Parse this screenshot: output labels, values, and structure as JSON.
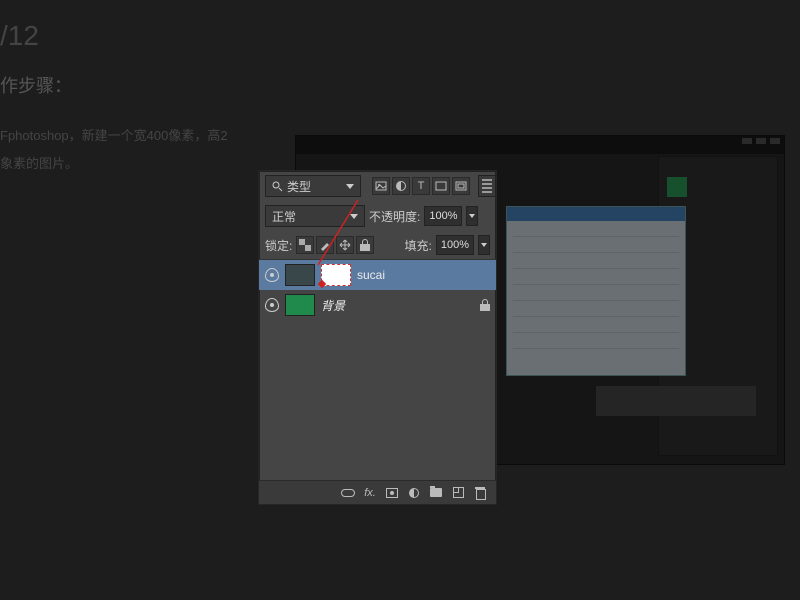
{
  "document": {
    "step_number": "/12",
    "step_title": "作步骤：",
    "body_line1": "Fphotoshop，新建一个宽400像素，高2",
    "body_line2": "象素的图片。"
  },
  "layers_panel": {
    "filter_type": "类型",
    "blend_mode": "正常",
    "opacity_label": "不透明度:",
    "opacity_value": "100%",
    "lock_label": "锁定:",
    "fill_label": "填充:",
    "fill_value": "100%",
    "layers": [
      {
        "name": "sucai",
        "selected": true
      },
      {
        "name": "背景",
        "selected": false,
        "locked": true
      }
    ],
    "footer_fx": "fx."
  },
  "icons": {
    "search": "🔍",
    "image": "▦",
    "adjust": "◐",
    "text": "T",
    "shape": "▱",
    "smart": "⊞",
    "pixels": "▩",
    "brush": "〰",
    "move": "✥",
    "lock": "🔒"
  }
}
